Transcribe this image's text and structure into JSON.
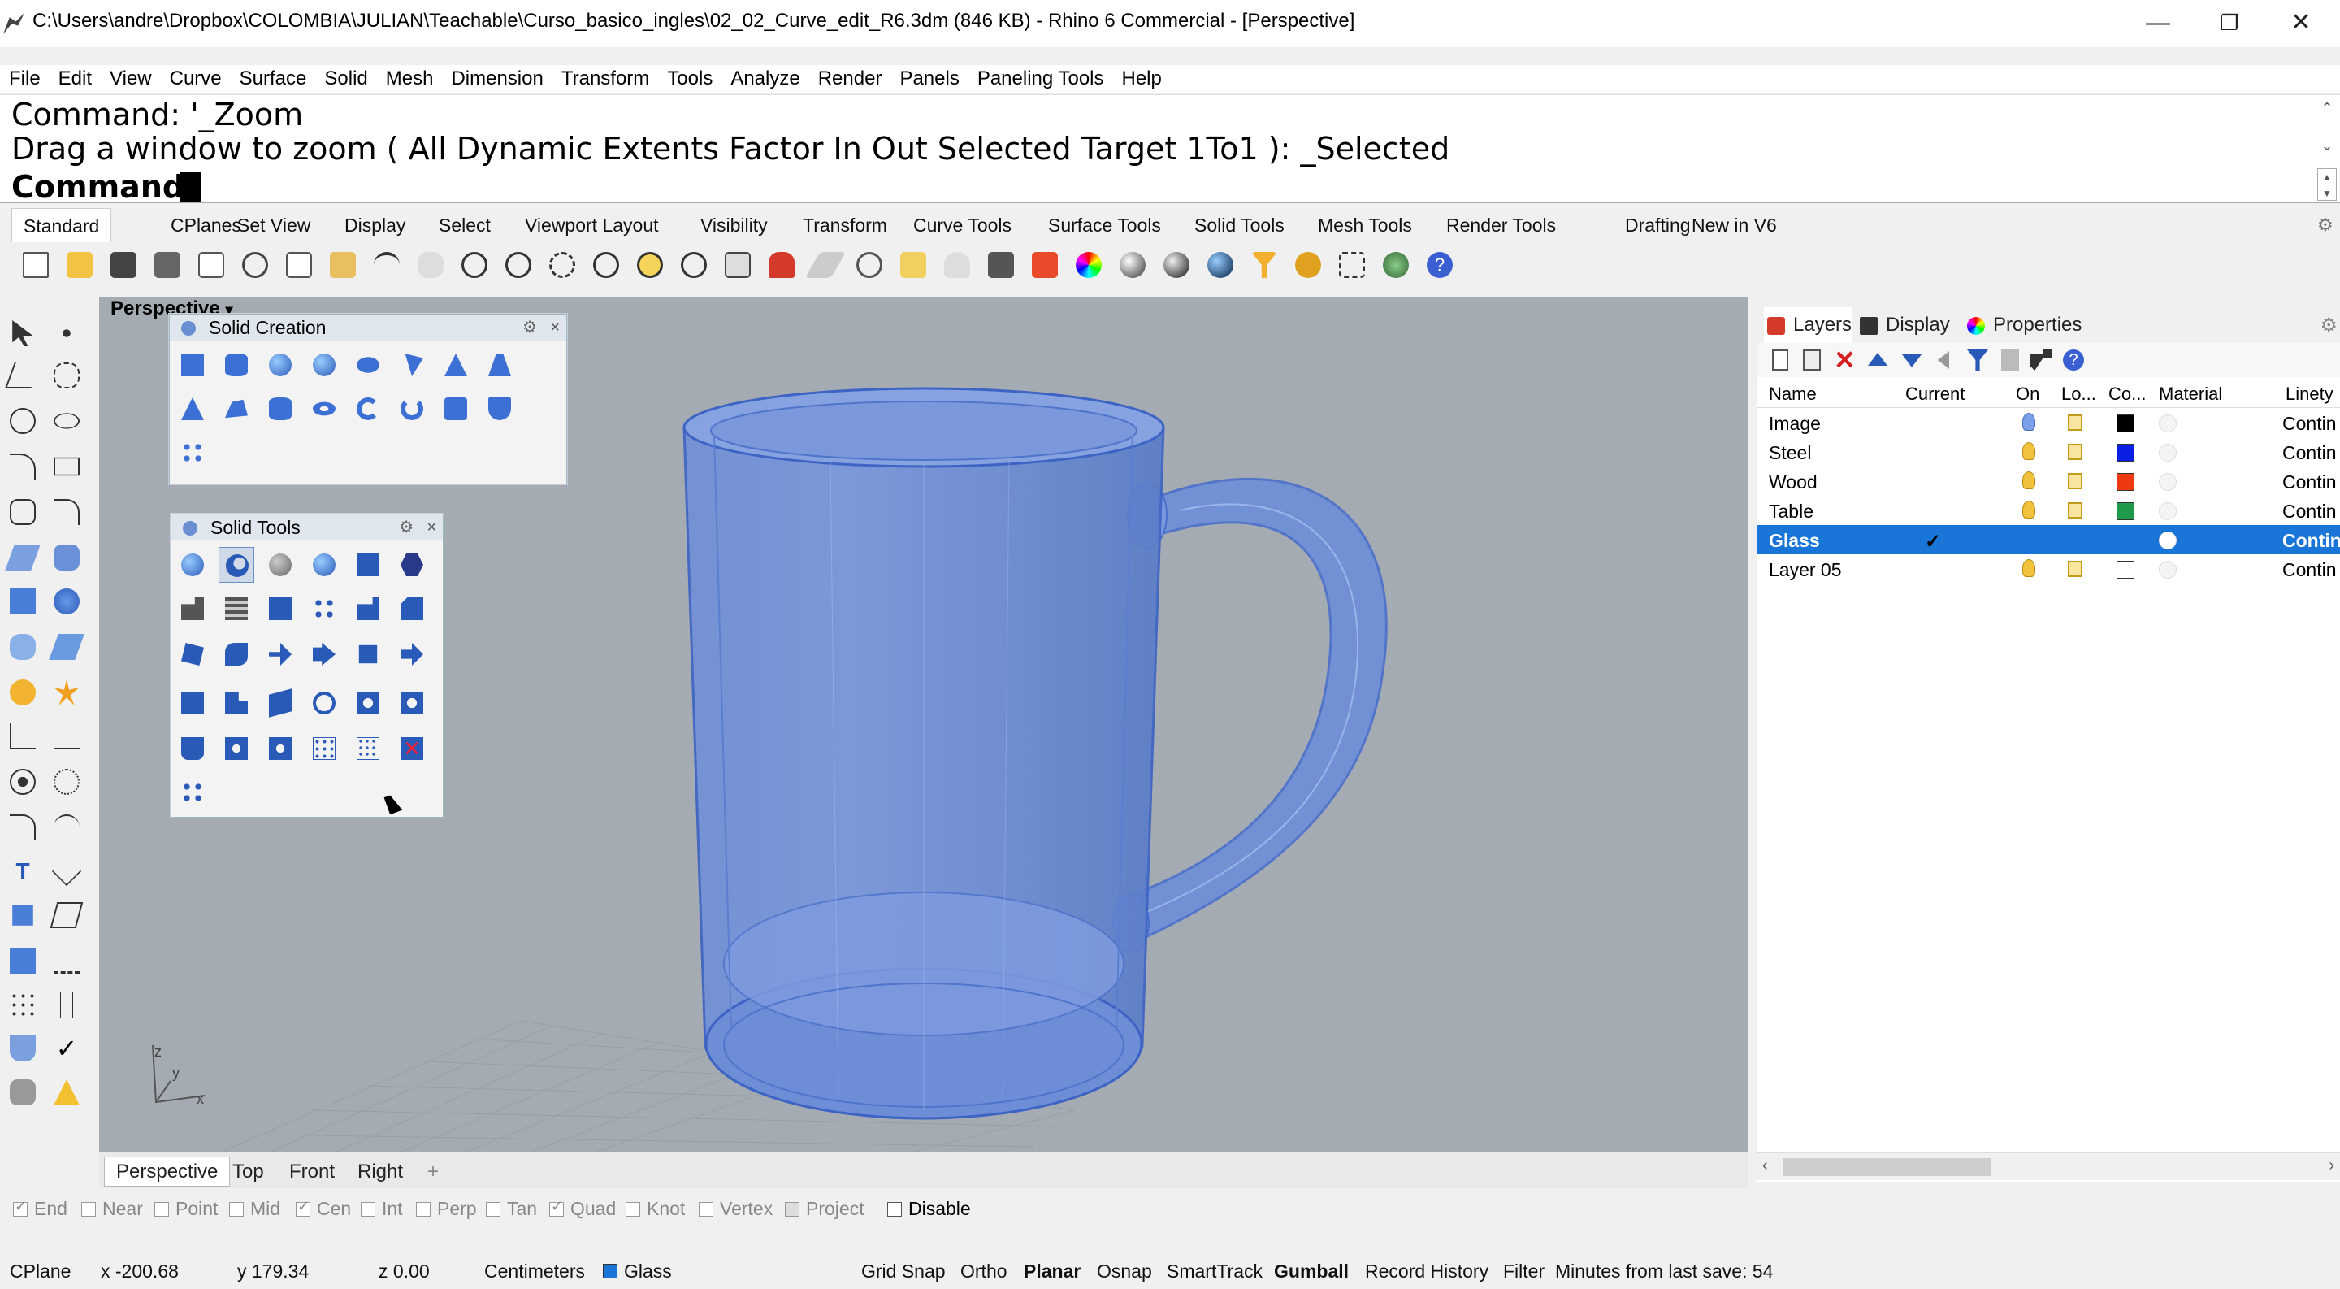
{
  "window": {
    "title": "C:\\Users\\andre\\Dropbox\\COLOMBIA\\JULIAN\\Teachable\\Curso_basico_ingles\\02_02_Curve_edit_R6.3dm (846 KB) - Rhino 6 Commercial - [Perspective]",
    "minimize": "—",
    "restore": "❐",
    "close": "✕"
  },
  "menu": [
    "File",
    "Edit",
    "View",
    "Curve",
    "Surface",
    "Solid",
    "Mesh",
    "Dimension",
    "Transform",
    "Tools",
    "Analyze",
    "Render",
    "Panels",
    "Paneling Tools",
    "Help"
  ],
  "command": {
    "history1": "Command: '_Zoom",
    "history2": "Drag a window to zoom ( All  Dynamic  Extents  Factor  In  Out  Selected  Target  1To1 ): _Selected",
    "prompt": "Command:"
  },
  "tabs": [
    "Standard",
    "CPlanes",
    "Set View",
    "Display",
    "Select",
    "Viewport Layout",
    "Visibility",
    "Transform",
    "Curve Tools",
    "Surface Tools",
    "Solid Tools",
    "Mesh Tools",
    "Render Tools",
    "Drafting",
    "New in V6"
  ],
  "viewport": {
    "label": "Perspective",
    "axes": {
      "z": "z",
      "y": "y",
      "x": "x"
    },
    "tabs": [
      "Perspective",
      "Top",
      "Front",
      "Right"
    ],
    "add_tab": "+"
  },
  "palettes": {
    "solid_creation": "Solid Creation",
    "solid_tools": "Solid Tools",
    "gear": "⚙",
    "close": "×"
  },
  "panel": {
    "tabs": [
      "Layers",
      "Display",
      "Properties"
    ],
    "columns": [
      "Name",
      "Current",
      "On",
      "Lo...",
      "Co...",
      "Material",
      "Linety"
    ],
    "layers": [
      {
        "name": "Image",
        "current": "",
        "color": "#000000",
        "linetype": "Contin"
      },
      {
        "name": "Steel",
        "current": "",
        "color": "#0a1ee6",
        "linetype": "Contin"
      },
      {
        "name": "Wood",
        "current": "",
        "color": "#ee3a10",
        "linetype": "Contin"
      },
      {
        "name": "Table",
        "current": "",
        "color": "#1f9a4a",
        "linetype": "Contin"
      },
      {
        "name": "Glass",
        "current": "✓",
        "color": "#1976d8",
        "linetype": "Contin"
      },
      {
        "name": "Layer 05",
        "current": "",
        "color": "#ffffff",
        "linetype": "Contin"
      }
    ]
  },
  "osnap": [
    {
      "label": "End",
      "checked": true
    },
    {
      "label": "Near",
      "checked": false
    },
    {
      "label": "Point",
      "checked": false
    },
    {
      "label": "Mid",
      "checked": false
    },
    {
      "label": "Cen",
      "checked": true
    },
    {
      "label": "Int",
      "checked": false
    },
    {
      "label": "Perp",
      "checked": false
    },
    {
      "label": "Tan",
      "checked": false
    },
    {
      "label": "Quad",
      "checked": true
    },
    {
      "label": "Knot",
      "checked": false
    },
    {
      "label": "Vertex",
      "checked": false
    },
    {
      "label": "Project",
      "checked": false
    },
    {
      "label": "Disable",
      "checked": false
    }
  ],
  "status": {
    "cplane": "CPlane",
    "x": "x -200.68",
    "y": "y 179.34",
    "z": "z 0.00",
    "units": "Centimeters",
    "layer": "Glass",
    "layer_color": "#1976d8",
    "grid_snap": "Grid Snap",
    "ortho": "Ortho",
    "planar": "Planar",
    "osnap": "Osnap",
    "smarttrack": "SmartTrack",
    "gumball": "Gumball",
    "record_history": "Record History",
    "filter": "Filter",
    "save_msg": "Minutes from last save: 54"
  }
}
